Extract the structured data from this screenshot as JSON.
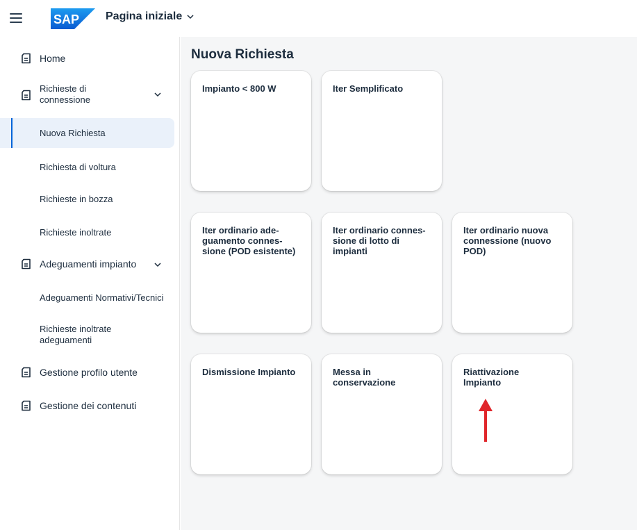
{
  "header": {
    "menu_icon": "hamburger-menu-icon",
    "logo_text": "SAP",
    "logo_color": "#0a6ed1",
    "title": "Pagina iniziale"
  },
  "sidebar": {
    "items": [
      {
        "label": "Home",
        "icon": "document-icon"
      },
      {
        "label_line1": "Richieste di",
        "label_line2": "connessione",
        "icon": "document-icon",
        "expanded": true
      },
      {
        "label": "Nuova Richiesta",
        "selected": true
      },
      {
        "label": "Richiesta di voltura"
      },
      {
        "label": "Richieste in bozza"
      },
      {
        "label": "Richieste inoltrate"
      },
      {
        "label": "Adeguamenti impianto",
        "icon": "document-icon",
        "expanded": true
      },
      {
        "label": "Adeguamenti Normativi/Tecnici"
      },
      {
        "label_line1": "Richieste inoltrate",
        "label_line2": "adeguamenti"
      },
      {
        "label": "Gestione profilo utente",
        "icon": "document-icon"
      },
      {
        "label": "Gestione dei contenuti",
        "icon": "document-icon"
      }
    ],
    "accent_color": "#0064d9"
  },
  "main": {
    "title": "Nuova Richiesta",
    "tiles": [
      {
        "title": "Impianto < 800 W"
      },
      {
        "title": "Iter Semplificato"
      },
      {
        "title_lines": [
          "Iter ordinario ade-",
          "guamento connes-",
          "sione (POD esistente)"
        ]
      },
      {
        "title_lines": [
          "Iter ordinario connes-",
          "sione di lotto di",
          "impianti"
        ]
      },
      {
        "title_lines": [
          "Iter ordinario nuova",
          "connessione (nuovo",
          "POD)"
        ]
      },
      {
        "title": "Dismissione Impianto"
      },
      {
        "title_lines": [
          "Messa in",
          "conservazione"
        ]
      },
      {
        "title_lines": [
          "Riattivazione",
          "Impianto"
        ]
      }
    ],
    "annotation": {
      "icon": "red-arrow-up-icon",
      "color": "#e0262b"
    }
  }
}
